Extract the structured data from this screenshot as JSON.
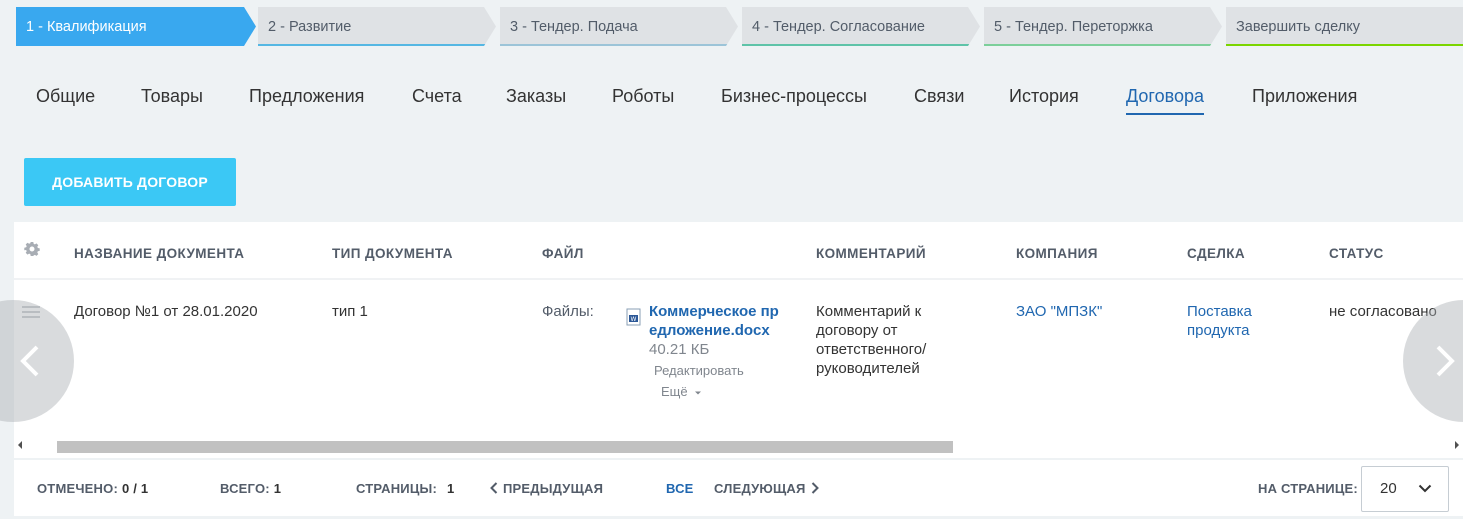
{
  "stages": [
    {
      "label": "1 - Квалификация",
      "color": "#39a8ef",
      "active": true
    },
    {
      "label": "2 - Развитие",
      "color": "#55b7e3"
    },
    {
      "label": "3 - Тендер. Подача",
      "color": "#9cc4d8"
    },
    {
      "label": "4 - Тендер. Согласование",
      "color": "#5ec3a8"
    },
    {
      "label": "5 - Тендер. Переторжка",
      "color": "#7ccf9a"
    },
    {
      "label": "Завершить сделку",
      "color": "#7bd500"
    }
  ],
  "tabs": [
    {
      "label": "Общие"
    },
    {
      "label": "Товары"
    },
    {
      "label": "Предложения"
    },
    {
      "label": "Счета"
    },
    {
      "label": "Заказы"
    },
    {
      "label": "Роботы"
    },
    {
      "label": "Бизнес-процессы"
    },
    {
      "label": "Связи"
    },
    {
      "label": "История"
    },
    {
      "label": "Договора",
      "active": true
    },
    {
      "label": "Приложения"
    }
  ],
  "add_button": "ДОБАВИТЬ ДОГОВОР",
  "grid": {
    "settings_icon": "gear-icon",
    "columns": [
      "НАЗВАНИЕ ДОКУМЕНТА",
      "ТИП ДОКУМЕНТА",
      "ФАЙЛ",
      "КОММЕНТАРИЙ",
      "КОМПАНИЯ",
      "СДЕЛКА",
      "СТАТУС"
    ],
    "row": {
      "name": "Договор №1 от 28.01.2020",
      "type": "тип 1",
      "files_label": "Файлы:",
      "file_name": "Коммерческое предложение.docx",
      "file_size": "40.21 КБ",
      "file_edit": "Редактировать",
      "file_more": "Ещё",
      "comment": "Комментарий к договору от ответственного/ руководителей",
      "company": "ЗАО \"МПЗК\"",
      "deal": "Поставка продукта",
      "status": "не согласовано"
    }
  },
  "footer": {
    "checked_label": "ОТМЕЧЕНО:",
    "checked_value": "0 / 1",
    "total_label": "ВСЕГО:",
    "total_value": "1",
    "pages_label": "СТРАНИЦЫ:",
    "pages_value": "1",
    "prev": "ПРЕДЫДУЩАЯ",
    "all": "ВСЕ",
    "next": "СЛЕДУЮЩАЯ",
    "per_page_label": "НА СТРАНИЦЕ:",
    "per_page_value": "20"
  }
}
